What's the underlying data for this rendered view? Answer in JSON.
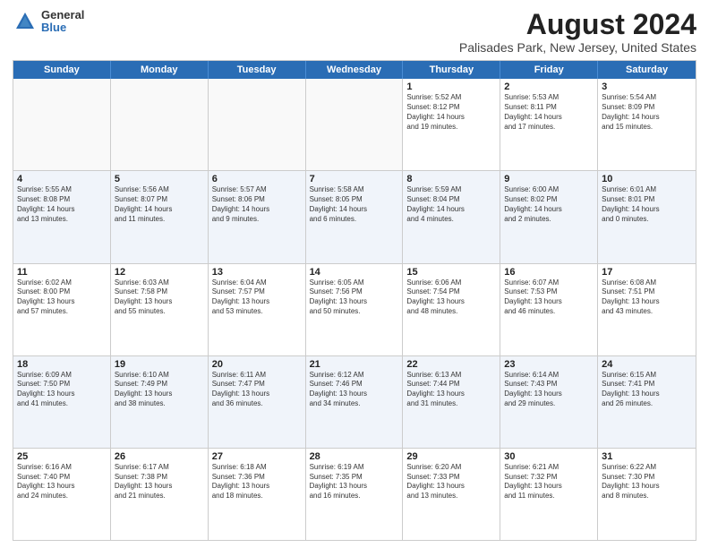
{
  "header": {
    "logo": {
      "general": "General",
      "blue": "Blue"
    },
    "title": "August 2024",
    "subtitle": "Palisades Park, New Jersey, United States"
  },
  "calendar": {
    "weekdays": [
      "Sunday",
      "Monday",
      "Tuesday",
      "Wednesday",
      "Thursday",
      "Friday",
      "Saturday"
    ],
    "rows": [
      [
        {
          "day": "",
          "lines": []
        },
        {
          "day": "",
          "lines": []
        },
        {
          "day": "",
          "lines": []
        },
        {
          "day": "",
          "lines": []
        },
        {
          "day": "1",
          "lines": [
            "Sunrise: 5:52 AM",
            "Sunset: 8:12 PM",
            "Daylight: 14 hours",
            "and 19 minutes."
          ]
        },
        {
          "day": "2",
          "lines": [
            "Sunrise: 5:53 AM",
            "Sunset: 8:11 PM",
            "Daylight: 14 hours",
            "and 17 minutes."
          ]
        },
        {
          "day": "3",
          "lines": [
            "Sunrise: 5:54 AM",
            "Sunset: 8:09 PM",
            "Daylight: 14 hours",
            "and 15 minutes."
          ]
        }
      ],
      [
        {
          "day": "4",
          "lines": [
            "Sunrise: 5:55 AM",
            "Sunset: 8:08 PM",
            "Daylight: 14 hours",
            "and 13 minutes."
          ]
        },
        {
          "day": "5",
          "lines": [
            "Sunrise: 5:56 AM",
            "Sunset: 8:07 PM",
            "Daylight: 14 hours",
            "and 11 minutes."
          ]
        },
        {
          "day": "6",
          "lines": [
            "Sunrise: 5:57 AM",
            "Sunset: 8:06 PM",
            "Daylight: 14 hours",
            "and 9 minutes."
          ]
        },
        {
          "day": "7",
          "lines": [
            "Sunrise: 5:58 AM",
            "Sunset: 8:05 PM",
            "Daylight: 14 hours",
            "and 6 minutes."
          ]
        },
        {
          "day": "8",
          "lines": [
            "Sunrise: 5:59 AM",
            "Sunset: 8:04 PM",
            "Daylight: 14 hours",
            "and 4 minutes."
          ]
        },
        {
          "day": "9",
          "lines": [
            "Sunrise: 6:00 AM",
            "Sunset: 8:02 PM",
            "Daylight: 14 hours",
            "and 2 minutes."
          ]
        },
        {
          "day": "10",
          "lines": [
            "Sunrise: 6:01 AM",
            "Sunset: 8:01 PM",
            "Daylight: 14 hours",
            "and 0 minutes."
          ]
        }
      ],
      [
        {
          "day": "11",
          "lines": [
            "Sunrise: 6:02 AM",
            "Sunset: 8:00 PM",
            "Daylight: 13 hours",
            "and 57 minutes."
          ]
        },
        {
          "day": "12",
          "lines": [
            "Sunrise: 6:03 AM",
            "Sunset: 7:58 PM",
            "Daylight: 13 hours",
            "and 55 minutes."
          ]
        },
        {
          "day": "13",
          "lines": [
            "Sunrise: 6:04 AM",
            "Sunset: 7:57 PM",
            "Daylight: 13 hours",
            "and 53 minutes."
          ]
        },
        {
          "day": "14",
          "lines": [
            "Sunrise: 6:05 AM",
            "Sunset: 7:56 PM",
            "Daylight: 13 hours",
            "and 50 minutes."
          ]
        },
        {
          "day": "15",
          "lines": [
            "Sunrise: 6:06 AM",
            "Sunset: 7:54 PM",
            "Daylight: 13 hours",
            "and 48 minutes."
          ]
        },
        {
          "day": "16",
          "lines": [
            "Sunrise: 6:07 AM",
            "Sunset: 7:53 PM",
            "Daylight: 13 hours",
            "and 46 minutes."
          ]
        },
        {
          "day": "17",
          "lines": [
            "Sunrise: 6:08 AM",
            "Sunset: 7:51 PM",
            "Daylight: 13 hours",
            "and 43 minutes."
          ]
        }
      ],
      [
        {
          "day": "18",
          "lines": [
            "Sunrise: 6:09 AM",
            "Sunset: 7:50 PM",
            "Daylight: 13 hours",
            "and 41 minutes."
          ]
        },
        {
          "day": "19",
          "lines": [
            "Sunrise: 6:10 AM",
            "Sunset: 7:49 PM",
            "Daylight: 13 hours",
            "and 38 minutes."
          ]
        },
        {
          "day": "20",
          "lines": [
            "Sunrise: 6:11 AM",
            "Sunset: 7:47 PM",
            "Daylight: 13 hours",
            "and 36 minutes."
          ]
        },
        {
          "day": "21",
          "lines": [
            "Sunrise: 6:12 AM",
            "Sunset: 7:46 PM",
            "Daylight: 13 hours",
            "and 34 minutes."
          ]
        },
        {
          "day": "22",
          "lines": [
            "Sunrise: 6:13 AM",
            "Sunset: 7:44 PM",
            "Daylight: 13 hours",
            "and 31 minutes."
          ]
        },
        {
          "day": "23",
          "lines": [
            "Sunrise: 6:14 AM",
            "Sunset: 7:43 PM",
            "Daylight: 13 hours",
            "and 29 minutes."
          ]
        },
        {
          "day": "24",
          "lines": [
            "Sunrise: 6:15 AM",
            "Sunset: 7:41 PM",
            "Daylight: 13 hours",
            "and 26 minutes."
          ]
        }
      ],
      [
        {
          "day": "25",
          "lines": [
            "Sunrise: 6:16 AM",
            "Sunset: 7:40 PM",
            "Daylight: 13 hours",
            "and 24 minutes."
          ]
        },
        {
          "day": "26",
          "lines": [
            "Sunrise: 6:17 AM",
            "Sunset: 7:38 PM",
            "Daylight: 13 hours",
            "and 21 minutes."
          ]
        },
        {
          "day": "27",
          "lines": [
            "Sunrise: 6:18 AM",
            "Sunset: 7:36 PM",
            "Daylight: 13 hours",
            "and 18 minutes."
          ]
        },
        {
          "day": "28",
          "lines": [
            "Sunrise: 6:19 AM",
            "Sunset: 7:35 PM",
            "Daylight: 13 hours",
            "and 16 minutes."
          ]
        },
        {
          "day": "29",
          "lines": [
            "Sunrise: 6:20 AM",
            "Sunset: 7:33 PM",
            "Daylight: 13 hours",
            "and 13 minutes."
          ]
        },
        {
          "day": "30",
          "lines": [
            "Sunrise: 6:21 AM",
            "Sunset: 7:32 PM",
            "Daylight: 13 hours",
            "and 11 minutes."
          ]
        },
        {
          "day": "31",
          "lines": [
            "Sunrise: 6:22 AM",
            "Sunset: 7:30 PM",
            "Daylight: 13 hours",
            "and 8 minutes."
          ]
        }
      ]
    ]
  }
}
